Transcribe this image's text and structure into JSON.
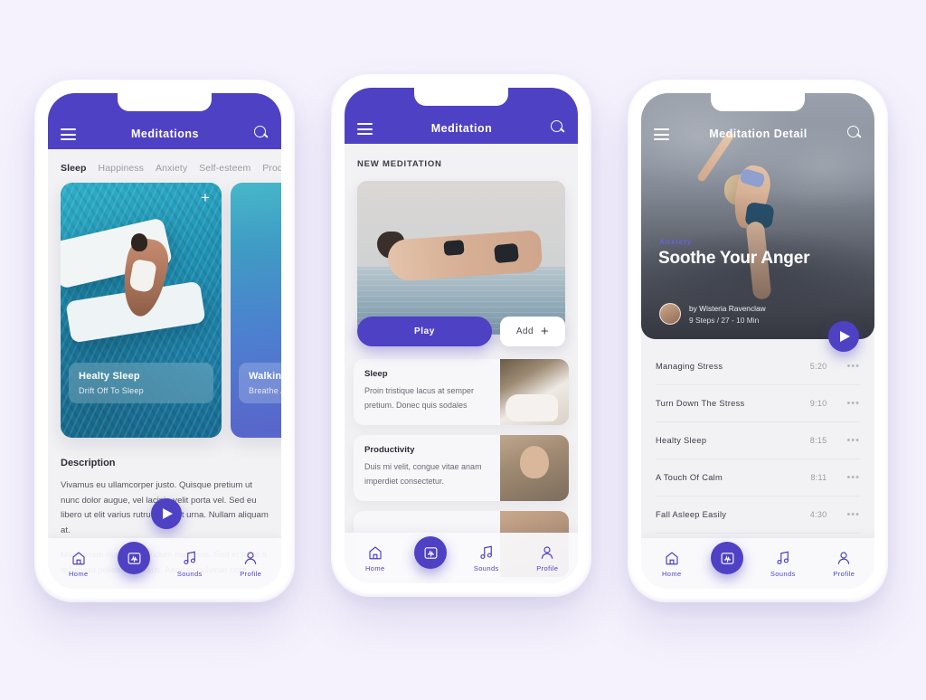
{
  "page": {
    "background_color": "#f5f2fd",
    "accent_color": "#4f41c4"
  },
  "phone1": {
    "appbar": {
      "title": "Meditations",
      "menu_icon": "hamburger-menu-icon",
      "search_icon": "search-icon"
    },
    "tabs": [
      {
        "label": "Sleep",
        "active": true
      },
      {
        "label": "Happiness",
        "active": false
      },
      {
        "label": "Anxiety",
        "active": false
      },
      {
        "label": "Self-esteem",
        "active": false
      },
      {
        "label": "Produ",
        "active": false
      }
    ],
    "cards": [
      {
        "title": "Healty Sleep",
        "subtitle": "Drift Off To Sleep",
        "add_icon": "plus-icon"
      },
      {
        "title": "Walking I",
        "subtitle": "Breathe Aw"
      }
    ],
    "play_icon": "play-icon",
    "description": {
      "heading": "Description",
      "paragraph1": "Vivamus eu ullamcorper justo. Quisque pretium ut nunc dolor augue, vel lacinia velit porta vel. Sed eu libero ut elit varius rutrum nec et urna. Nullam aliquam at.",
      "paragraph2": "Mauris non massa bibendum maximus. Sed et justo a tellus atu pellentes cursus. Aenean pulvinar nom"
    },
    "nav": {
      "items": [
        {
          "label": "Home",
          "icon": "home-icon"
        },
        {
          "label": "Sounds",
          "icon": "music-note-icon"
        },
        {
          "label": "Profile",
          "icon": "person-icon"
        }
      ],
      "center_icon": "meditation-icon"
    }
  },
  "phone2": {
    "appbar": {
      "title": "Meditation",
      "menu_icon": "hamburger-menu-icon",
      "search_icon": "search-icon"
    },
    "section_label": "NEW MEDITATION",
    "buttons": {
      "play": "Play",
      "add": "Add",
      "add_icon": "plus-icon"
    },
    "list": [
      {
        "title": "Sleep",
        "subtitle": "Proin tristique lacus at semper pretium. Donec quis sodales"
      },
      {
        "title": "Productivity",
        "subtitle": "Duis mi velit, congue vitae anam imperdiet consectetur."
      }
    ],
    "nav": {
      "items": [
        {
          "label": "Home",
          "icon": "home-icon"
        },
        {
          "label": "Sounds",
          "icon": "music-note-icon"
        },
        {
          "label": "Profile",
          "icon": "person-icon"
        }
      ],
      "center_icon": "meditation-icon"
    }
  },
  "phone3": {
    "appbar": {
      "title": "Meditation Detail",
      "menu_icon": "hamburger-menu-icon",
      "search_icon": "search-icon"
    },
    "hero": {
      "tag": "Anxiety",
      "title": "Soothe Your Anger",
      "author": "by Wisteria Ravenclaw",
      "meta": "9 Steps / 27 - 10 Min",
      "avatar": "author-avatar",
      "play_icon": "play-icon"
    },
    "tracks": [
      {
        "name": "Managing Stress",
        "duration": "5:20",
        "more": "•••"
      },
      {
        "name": "Turn Down The Stress",
        "duration": "9:10",
        "more": "•••"
      },
      {
        "name": "Healty Sleep",
        "duration": "8:15",
        "more": "•••"
      },
      {
        "name": "A Touch Of Calm",
        "duration": "8:11",
        "more": "•••"
      },
      {
        "name": "Fall Asleep Easily",
        "duration": "4:30",
        "more": "•••"
      }
    ],
    "nav": {
      "items": [
        {
          "label": "Home",
          "icon": "home-icon"
        },
        {
          "label": "Sounds",
          "icon": "music-note-icon"
        },
        {
          "label": "Profile",
          "icon": "person-icon"
        }
      ],
      "center_icon": "meditation-icon"
    }
  }
}
